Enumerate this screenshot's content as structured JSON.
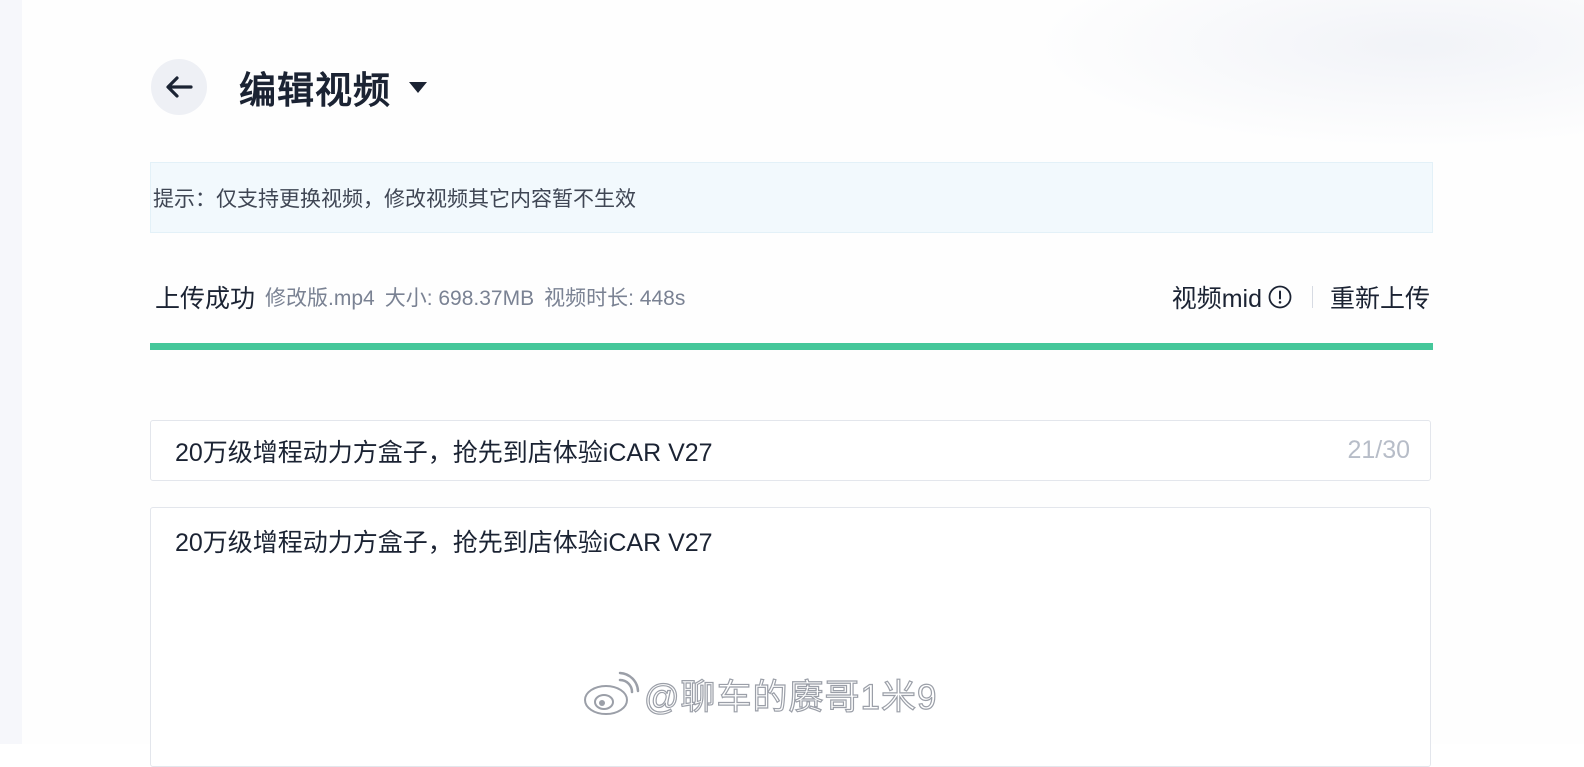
{
  "header": {
    "title": "编辑视频"
  },
  "tip": {
    "text": "提示：仅支持更换视频，修改视频其它内容暂不生效"
  },
  "upload": {
    "status": "上传成功",
    "filename": "修改版.mp4",
    "size": "大小: 698.37MB",
    "duration": "视频时长: 448s",
    "mid_label": "视频mid",
    "reupload_label": "重新上传",
    "progress_percent": 100,
    "progress_color": "#45c79a"
  },
  "form": {
    "title_value": "20万级增程动力方盒子，抢先到店体验iCAR V27",
    "title_counter": "21/30",
    "description_value": "20万级增程动力方盒子，抢先到店体验iCAR V27"
  },
  "watermark": {
    "text": "@聊车的赓哥1米9"
  },
  "icons": [
    "back-arrow-icon",
    "caret-down-icon",
    "info-circle-icon",
    "weibo-logo-icon"
  ]
}
